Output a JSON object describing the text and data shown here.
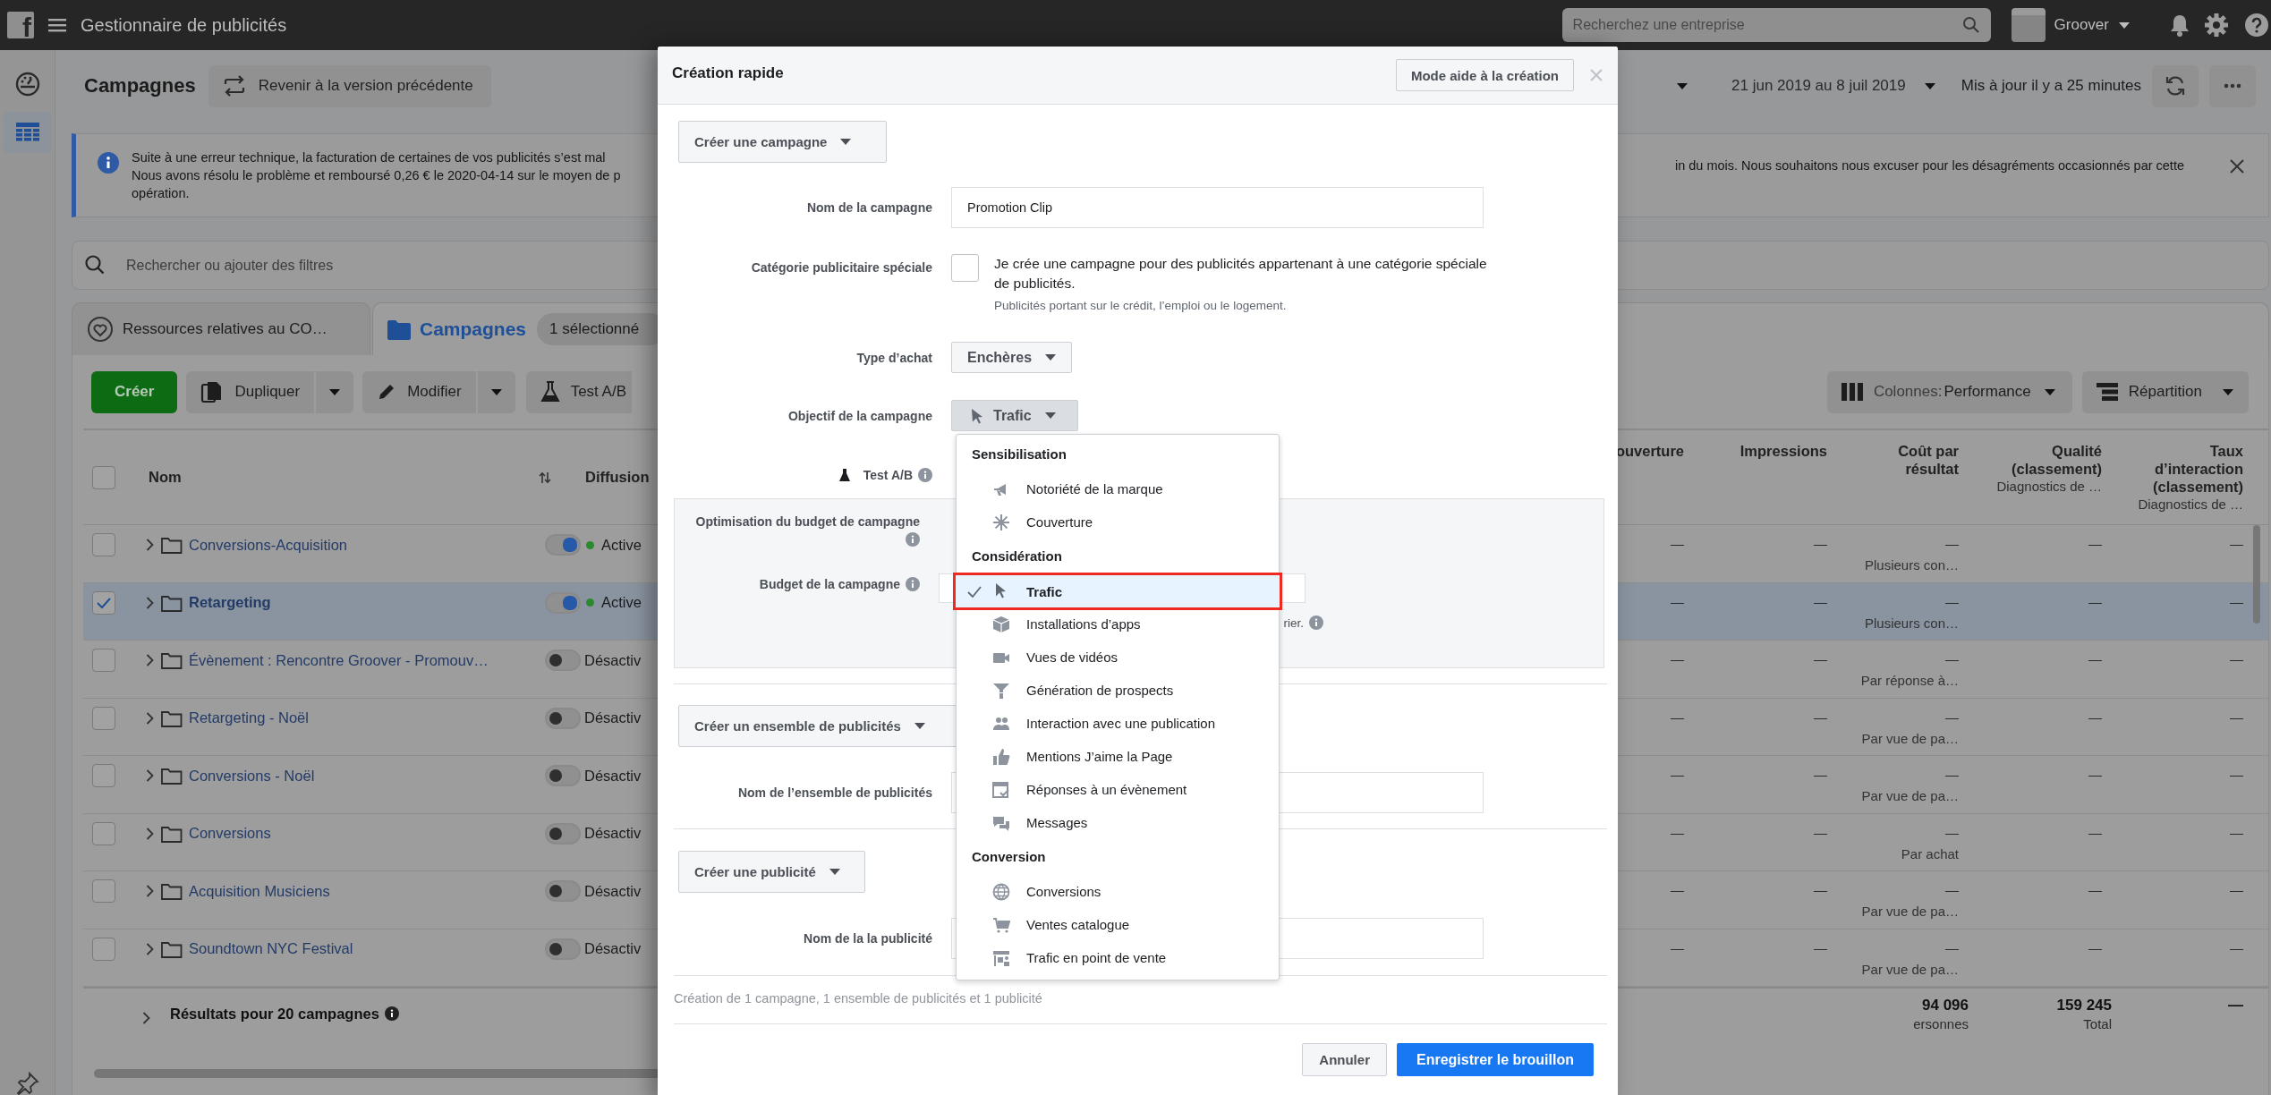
{
  "top_bar": {
    "logo": "f",
    "app_title": "Gestionnaire de publicités",
    "search": {
      "placeholder": "Recherchez une entreprise"
    },
    "account": "Groover"
  },
  "sidebar": {
    "items": [
      {
        "selected": false
      },
      {
        "selected": true
      }
    ]
  },
  "page_header": {
    "title": "Campagnes",
    "revert_button": "Revenir à la version précédente",
    "date_range": "21 jun 2019 au 8 juil 2019",
    "updated": "Mis à jour il y a 25 minutes"
  },
  "notice": {
    "left_lines": [
      "Suite à une erreur technique, la facturation de certaines de vos publicités s’est mal",
      "Nous avons résolu le problème et remboursé 0,26 € le 2020-04-14 sur le moyen de p",
      "opération."
    ],
    "right_text": "in du mois. Nous souhaitons nous excuser pour les désagréments occasionnés par cette"
  },
  "filter_search": {
    "placeholder": "Rechercher ou ajouter des filtres"
  },
  "tabs": [
    {
      "label": "Ressources relatives au CO…",
      "selected": false
    },
    {
      "label": "Campagnes",
      "selected": true,
      "badge": "1 sélectionné"
    }
  ],
  "toolbar": {
    "create": "Créer",
    "duplicate": "Dupliquer",
    "edit": "Modifier",
    "ab_test": "Test A/B",
    "columns_label": "Colonnes:",
    "columns_value": "Performance",
    "breakdown": "Répartition"
  },
  "table": {
    "select_all": {
      "checked": false
    },
    "columns": [
      {
        "label": "Nom"
      },
      {
        "label": "Diffusion"
      }
    ],
    "metric_columns": [
      {
        "label": "ouverture"
      },
      {
        "label": "Impressions"
      },
      {
        "label": "Coût par résultat"
      },
      {
        "label": "Qualité (classement)",
        "sub": "Diagnostics de …"
      },
      {
        "label": "Taux d’interaction (classement)",
        "sub": "Diagnostics de …"
      }
    ],
    "rows": [
      {
        "name": "Conversions-Acquisition",
        "checked": false,
        "selected": false,
        "on": true,
        "delivery": "Active",
        "metrics": [
          "—",
          "—",
          "—",
          "—",
          "—"
        ],
        "result_type": "Plusieurs con…"
      },
      {
        "name": "Retargeting",
        "checked": true,
        "selected": true,
        "on": true,
        "delivery": "Active",
        "metrics": [
          "—",
          "—",
          "—",
          "—",
          "—"
        ],
        "result_type": "Plusieurs con…"
      },
      {
        "name": "Évènement : Rencontre Groover - Promouv…",
        "checked": false,
        "selected": false,
        "on": false,
        "delivery": "Désactiv",
        "metrics": [
          "—",
          "—",
          "—",
          "—",
          "—"
        ],
        "result_type": "Par réponse à…"
      },
      {
        "name": "Retargeting - Noël",
        "checked": false,
        "selected": false,
        "on": false,
        "delivery": "Désactiv",
        "metrics": [
          "—",
          "—",
          "—",
          "—",
          "—"
        ],
        "result_type": "Par vue de pa…"
      },
      {
        "name": "Conversions - Noël",
        "checked": false,
        "selected": false,
        "on": false,
        "delivery": "Désactiv",
        "metrics": [
          "—",
          "—",
          "—",
          "—",
          "—"
        ],
        "result_type": "Par vue de pa…"
      },
      {
        "name": "Conversions",
        "checked": false,
        "selected": false,
        "on": false,
        "delivery": "Désactiv",
        "metrics": [
          "—",
          "—",
          "—",
          "—",
          "—"
        ],
        "result_type": "Par achat"
      },
      {
        "name": "Acquisition Musiciens",
        "checked": false,
        "selected": false,
        "on": false,
        "delivery": "Désactiv",
        "metrics": [
          "—",
          "—",
          "—",
          "—",
          "—"
        ],
        "result_type": "Par vue de pa…"
      },
      {
        "name": "Soundtown NYC Festival",
        "checked": false,
        "selected": false,
        "on": false,
        "delivery": "Désactiv",
        "metrics": [
          "—",
          "—",
          "—",
          "—",
          "—"
        ],
        "result_type": "Par vue de pa…"
      }
    ],
    "summary": {
      "label": "Résultats pour 20 campagnes",
      "metrics": [
        {
          "value": "94 096",
          "unit": "ersonnes"
        },
        {
          "value": "159 245",
          "unit": "Total"
        },
        {
          "value": "—"
        }
      ]
    }
  },
  "dialog": {
    "title": "Création rapide",
    "guided_button": "Mode aide à la création",
    "campaign": {
      "section_button": "Créer une campagne",
      "name_label": "Nom de la campagne",
      "name_value": "Promotion Clip",
      "special_label": "Catégorie publicitaire spéciale",
      "special_checked": false,
      "special_text": "Je crée une campagne pour des publicités appartenant à une catégorie spéciale de publicités.",
      "special_help": "Publicités portant sur le crédit, l’emploi ou le logement.",
      "buying_label": "Type d’achat",
      "buying_value": "Enchères",
      "objective_label": "Objectif de la campagne",
      "objective_value": "Trafic",
      "ab_label": "Test A/B",
      "cbo_label": "Optimisation du budget de campagne",
      "budget_label": "Budget de la campagne",
      "budget_note": "rier."
    },
    "ad_set": {
      "section_button": "Créer un ensemble de publicités",
      "name_label": "Nom de l’ensemble de publicités"
    },
    "ad": {
      "section_button": "Créer une publicité",
      "name_label": "Nom de la la publicité"
    },
    "summary": "Création de 1 campagne, 1 ensemble de publicités et 1 publicité",
    "buttons": {
      "cancel": "Annuler",
      "save": "Enregistrer le brouillon"
    }
  },
  "objective_menu": {
    "groups": [
      {
        "title": "Sensibilisation",
        "items": [
          {
            "label": "Notoriété de la marque",
            "selected": false
          },
          {
            "label": "Couverture",
            "selected": false
          }
        ]
      },
      {
        "title": "Considération",
        "items": [
          {
            "label": "Trafic",
            "selected": true
          },
          {
            "label": "Installations d’apps",
            "selected": false
          },
          {
            "label": "Vues de vidéos",
            "selected": false
          },
          {
            "label": "Génération de prospects",
            "selected": false
          },
          {
            "label": "Interaction avec une publication",
            "selected": false
          },
          {
            "label": "Mentions J’aime la Page",
            "selected": false
          },
          {
            "label": "Réponses à un évènement",
            "selected": false
          },
          {
            "label": "Messages",
            "selected": false
          }
        ]
      },
      {
        "title": "Conversion",
        "items": [
          {
            "label": "Conversions",
            "selected": false
          },
          {
            "label": "Ventes catalogue",
            "selected": false
          },
          {
            "label": "Trafic en point de vente",
            "selected": false
          }
        ]
      }
    ]
  }
}
